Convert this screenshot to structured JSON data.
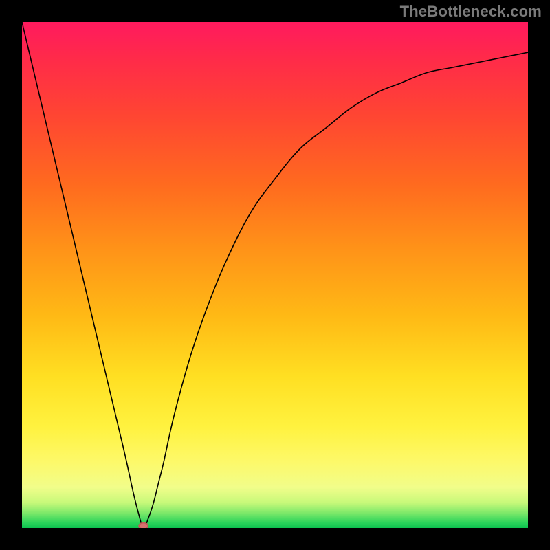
{
  "watermark": "TheBottleneck.com",
  "chart_data": {
    "type": "line",
    "title": "",
    "xlabel": "",
    "ylabel": "",
    "xlim": [
      0,
      100
    ],
    "ylim": [
      0,
      100
    ],
    "grid": false,
    "legend": false,
    "series": [
      {
        "name": "bottleneck-curve",
        "x": [
          0,
          5,
          10,
          15,
          20,
          22,
          23,
          24,
          25,
          26,
          27,
          28,
          30,
          33,
          36,
          40,
          45,
          50,
          55,
          60,
          65,
          70,
          75,
          80,
          85,
          90,
          95,
          100
        ],
        "values": [
          100,
          79,
          58,
          37,
          16,
          7,
          3,
          0,
          2,
          5,
          9,
          13,
          22,
          33,
          42,
          52,
          62,
          69,
          75,
          79,
          83,
          86,
          88,
          90,
          91,
          92,
          93,
          94
        ]
      }
    ],
    "marker": {
      "x": 24,
      "y": 0,
      "name": "optimum-point"
    },
    "gradient_stops": [
      {
        "pct": 0,
        "color": "#ff1a5e"
      },
      {
        "pct": 7,
        "color": "#ff2a4a"
      },
      {
        "pct": 18,
        "color": "#ff4433"
      },
      {
        "pct": 32,
        "color": "#ff6a1f"
      },
      {
        "pct": 45,
        "color": "#ff9318"
      },
      {
        "pct": 58,
        "color": "#ffb915"
      },
      {
        "pct": 70,
        "color": "#ffdf22"
      },
      {
        "pct": 80,
        "color": "#fff23f"
      },
      {
        "pct": 87,
        "color": "#fdf96a"
      },
      {
        "pct": 92,
        "color": "#f1fd8a"
      },
      {
        "pct": 95,
        "color": "#c7f97a"
      },
      {
        "pct": 97,
        "color": "#7fe96a"
      },
      {
        "pct": 99,
        "color": "#29d35a"
      },
      {
        "pct": 100,
        "color": "#0dc14f"
      }
    ]
  }
}
